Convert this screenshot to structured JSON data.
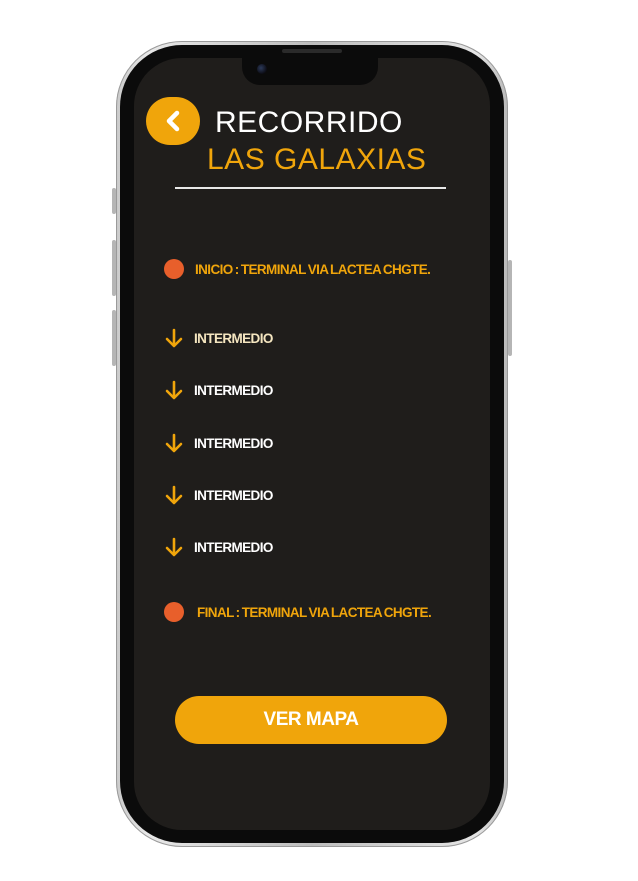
{
  "header": {
    "back_icon": "chevron-left-icon",
    "title_line1": "RECORRIDO",
    "title_line2": "LAS GALAXIAS"
  },
  "route": {
    "start": {
      "label": "INICIO :  TERMINAL VIA LACTEA CHGTE.",
      "marker": "circle-dot"
    },
    "intermediate": [
      {
        "label": "INTERMEDIO",
        "icon": "arrow-down-icon"
      },
      {
        "label": "INTERMEDIO",
        "icon": "arrow-down-icon"
      },
      {
        "label": "INTERMEDIO",
        "icon": "arrow-down-icon"
      },
      {
        "label": "INTERMEDIO",
        "icon": "arrow-down-icon"
      },
      {
        "label": "INTERMEDIO",
        "icon": "arrow-down-icon"
      }
    ],
    "end": {
      "label": "FINAL :  TERMINAL VIA LACTEA CHGTE.",
      "marker": "circle-dot"
    }
  },
  "actions": {
    "view_map_label": "VER MAPA"
  },
  "colors": {
    "accent": "#f0a50b",
    "marker": "#e85f2b",
    "background": "#1f1d1b",
    "text": "#ffffff"
  }
}
